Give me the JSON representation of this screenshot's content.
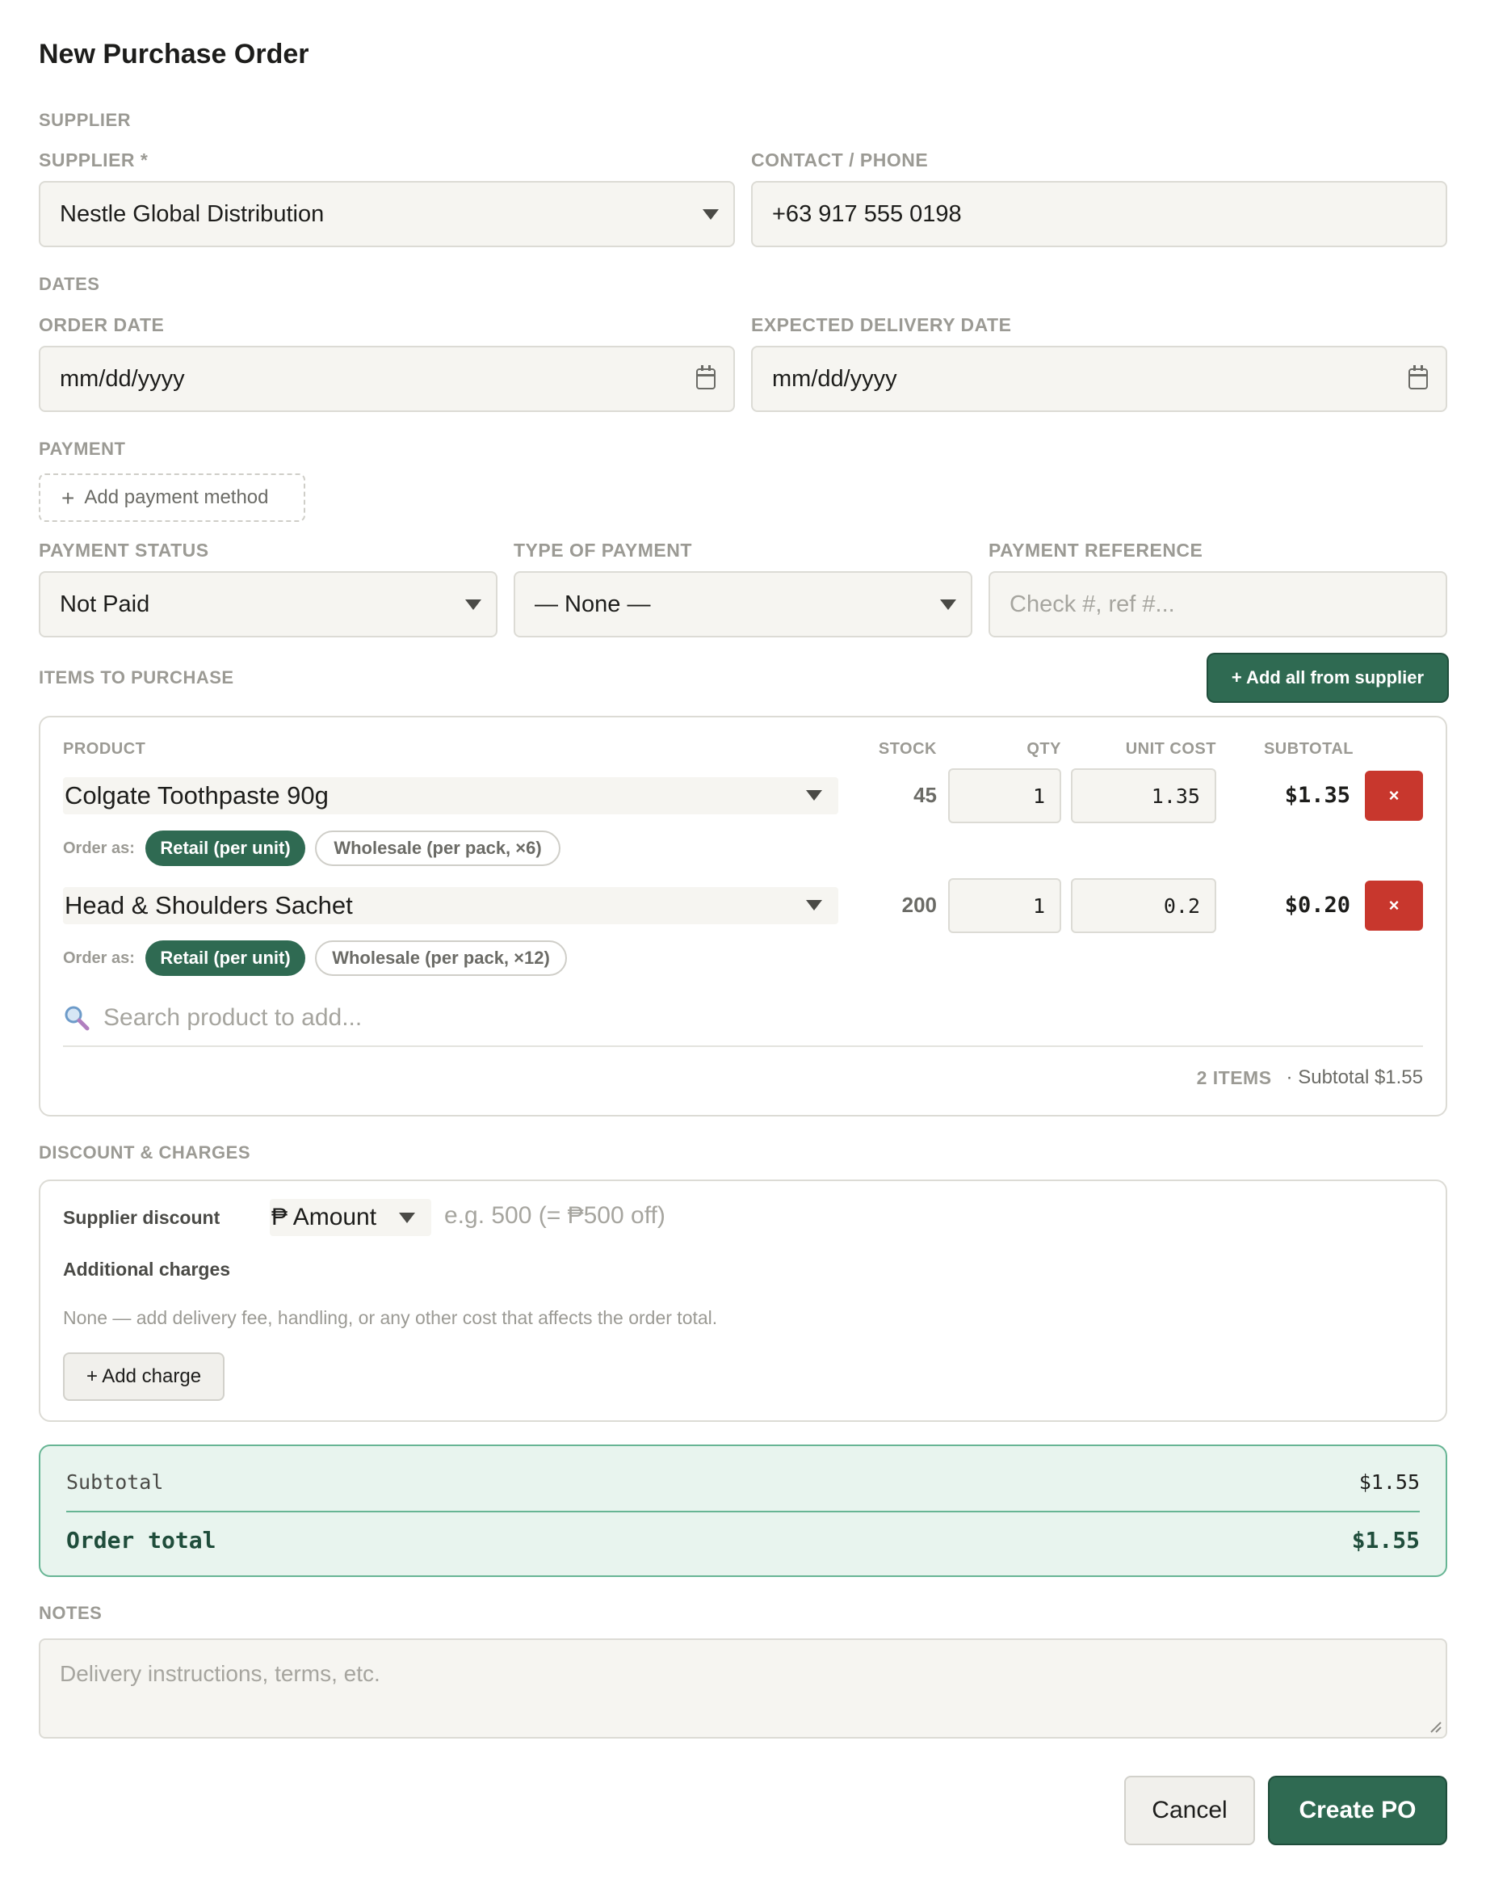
{
  "modal": {
    "title": "New Purchase Order"
  },
  "supplier_section": {
    "label": "SUPPLIER",
    "supplier_label": "SUPPLIER *",
    "supplier_value": "Nestle Global Distribution",
    "contact_label": "CONTACT / PHONE",
    "contact_value": "+63 917 555 0198"
  },
  "dates_section": {
    "label": "DATES",
    "order_date_label": "ORDER DATE",
    "order_date_value": "mm/dd/yyyy",
    "delivery_date_label": "EXPECTED DELIVERY DATE",
    "delivery_date_value": "mm/dd/yyyy"
  },
  "payment_section": {
    "label": "PAYMENT",
    "add_method_label": "Add payment method",
    "status_label": "PAYMENT STATUS",
    "status_value": "Not Paid",
    "type_label": "TYPE OF PAYMENT",
    "type_value": "— None —",
    "reference_label": "PAYMENT REFERENCE",
    "reference_placeholder": "Check #, ref #..."
  },
  "items_section": {
    "label": "ITEMS TO PURCHASE",
    "add_all_label": "+ Add all from supplier",
    "columns": {
      "product": "PRODUCT",
      "stock": "STOCK",
      "qty": "QTY",
      "unit_cost": "UNIT COST",
      "subtotal": "SUBTOTAL"
    },
    "order_as_label": "Order as:",
    "items": [
      {
        "product": "Colgate Toothpaste 90g",
        "stock": "45",
        "qty": "1",
        "unit_cost": "1.35",
        "subtotal": "$1.35",
        "retail_label": "Retail (per unit)",
        "wholesale_label": "Wholesale (per pack, ×6)"
      },
      {
        "product": "Head & Shoulders Sachet",
        "stock": "200",
        "qty": "1",
        "unit_cost": "0.2",
        "subtotal": "$0.20",
        "retail_label": "Retail (per unit)",
        "wholesale_label": "Wholesale (per pack, ×12)"
      }
    ],
    "delete_glyph": "×",
    "search_placeholder": "Search product to add...",
    "summary_count": "2 ITEMS",
    "summary_subtotal": "· Subtotal $1.55"
  },
  "discount_section": {
    "label": "DISCOUNT & CHARGES",
    "supplier_discount_label": "Supplier discount",
    "discount_type": "₱ Amount",
    "discount_placeholder": "e.g. 500 (= ₱500 off)",
    "additional_label": "Additional charges",
    "additional_note": "None — add delivery fee, handling, or any other cost that affects the order total.",
    "add_charge_label": "+ Add charge"
  },
  "totals": {
    "subtotal_label": "Subtotal",
    "subtotal_value": "$1.55",
    "order_total_label": "Order total",
    "order_total_value": "$1.55"
  },
  "notes_section": {
    "label": "NOTES",
    "placeholder": "Delivery instructions, terms, etc."
  },
  "footer": {
    "cancel_label": "Cancel",
    "create_label": "Create PO"
  },
  "colors": {
    "accent": "#2f6a52",
    "danger": "#c8372d",
    "total_bg": "#e8f4ee",
    "total_border": "#67b594"
  }
}
